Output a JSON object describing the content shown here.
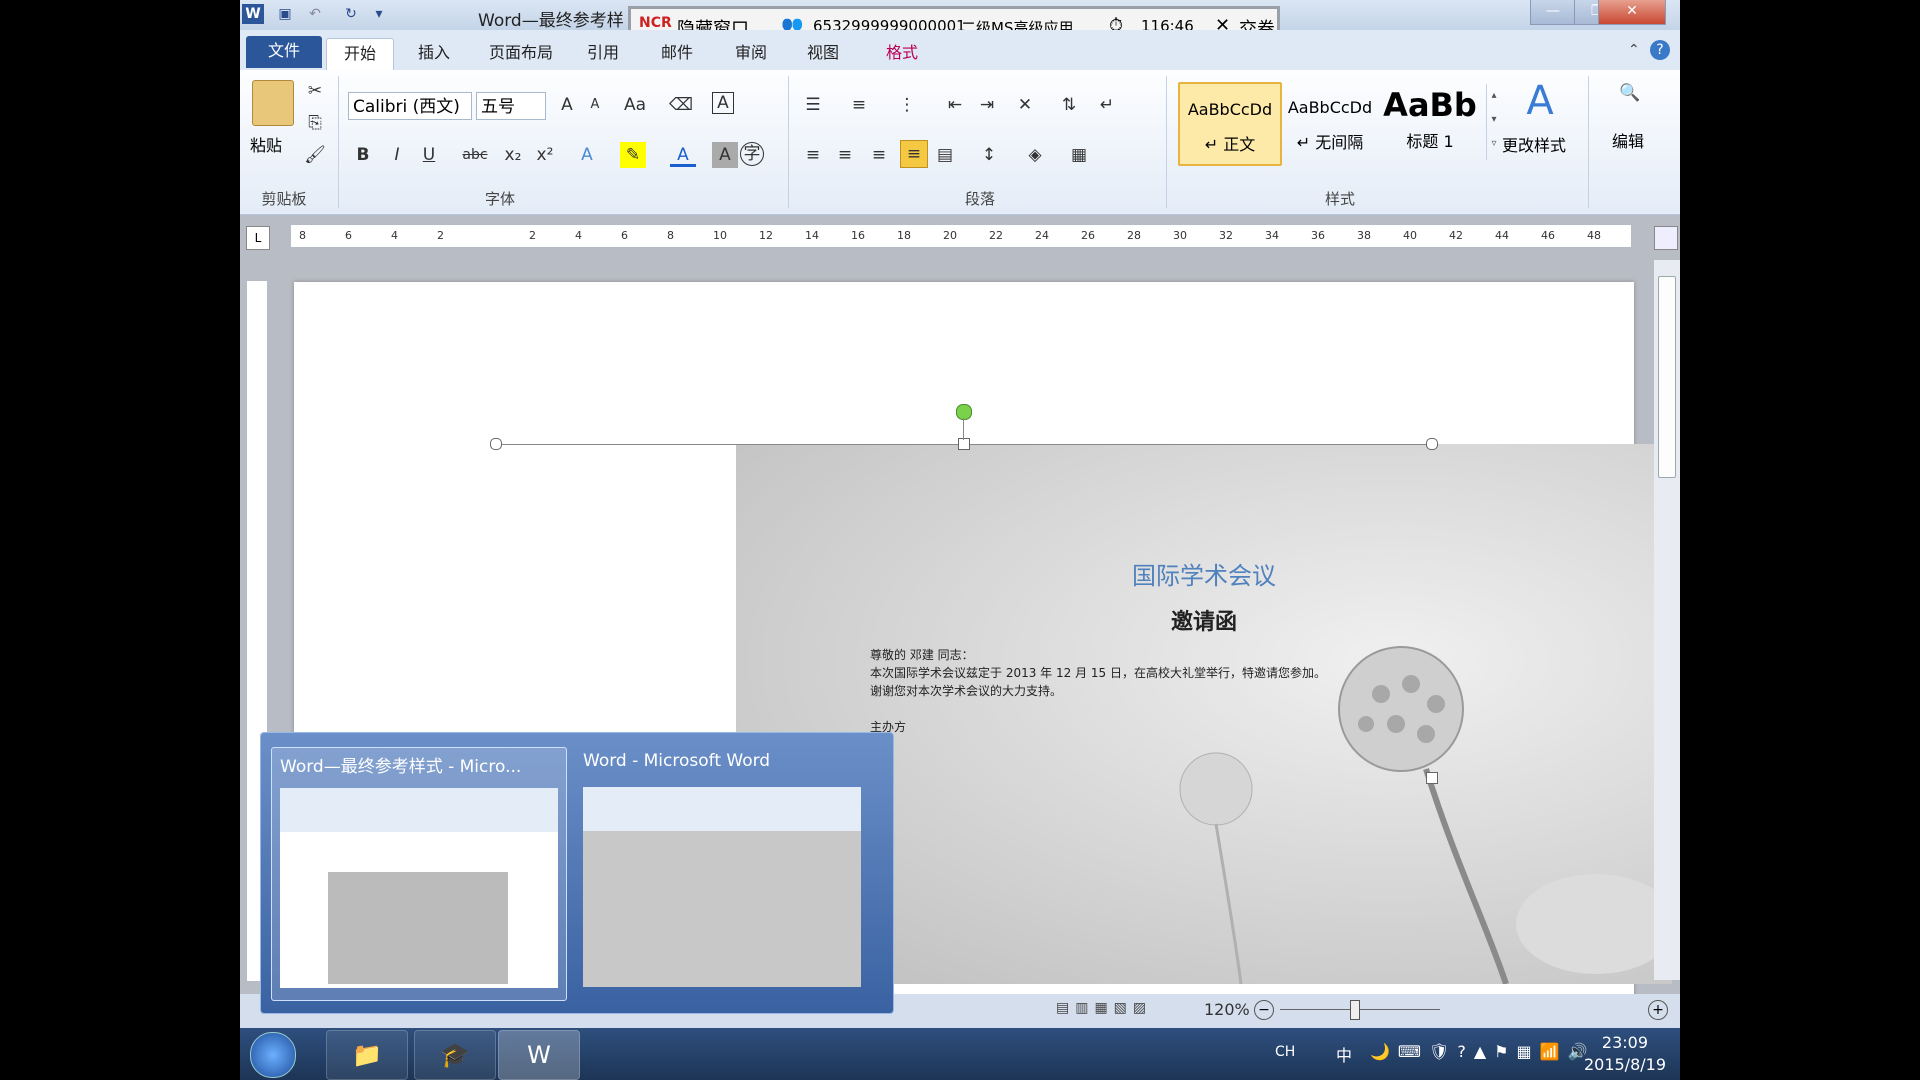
{
  "window": {
    "title": "Word—最终参考样",
    "qat_icons": [
      "word-icon",
      "save-icon",
      "undo-icon",
      "redo-icon",
      "customize-icon"
    ]
  },
  "exam": {
    "hide_label": "隐藏窗口",
    "candidate_id": "6532999999000001",
    "subject": "二级MS高级应用",
    "time": "116:46",
    "submit_label": "交卷"
  },
  "ribbon_tabs": [
    "文件",
    "开始",
    "插入",
    "页面布局",
    "引用",
    "邮件",
    "审阅",
    "视图",
    "格式"
  ],
  "ribbon": {
    "paste_label": "粘贴",
    "font_name": "Calibri (西文)",
    "font_size": "五号",
    "groups": {
      "clipboard": "剪贴板",
      "font": "字体",
      "paragraph": "段落",
      "styles": "样式"
    },
    "styles": [
      {
        "preview": "AaBbCcDd",
        "name": "↵ 正文"
      },
      {
        "preview": "AaBbCcDd",
        "name": "↵ 无间隔"
      },
      {
        "preview": "AaBb",
        "name": "标题 1"
      }
    ],
    "change_styles_label": "更改样式",
    "edit_label": "编辑"
  },
  "ruler_ticks": [
    "8",
    "6",
    "4",
    "2",
    "",
    "2",
    "4",
    "6",
    "8",
    "10",
    "12",
    "14",
    "16",
    "18",
    "20",
    "22",
    "24",
    "26",
    "28",
    "30",
    "32",
    "34",
    "36",
    "38",
    "40",
    "42",
    "44",
    "46",
    "48"
  ],
  "document": {
    "heading": "国际学术会议",
    "subheading": "邀请函",
    "line1": "尊敬的        邓建   同志：",
    "line2": "本次国际学术会议兹定于 2013 年 12 月 15 日，在高校大礼堂举行，特邀请您参加。",
    "line3": "谢谢您对本次学术会议的大力支持。",
    "line4": "主办方"
  },
  "status": {
    "zoom": "120%"
  },
  "thumbnails": [
    {
      "title": "Word—最终参考样式 - Micro..."
    },
    {
      "title": "Word - Microsoft Word"
    }
  ],
  "taskbar": {
    "tray": [
      "CH",
      "中"
    ],
    "time": "23:09",
    "date": "2015/8/19"
  }
}
